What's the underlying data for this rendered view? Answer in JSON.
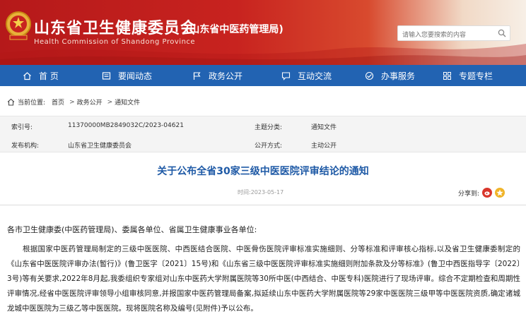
{
  "header": {
    "title": "山东省卫生健康委员会",
    "subtitle": "(山东省中医药管理局)",
    "english": "Health Commission of Shandong Province",
    "search_placeholder": "请输入您要搜索的内容"
  },
  "nav": {
    "items": [
      {
        "label": "首 页",
        "icon": "home-icon"
      },
      {
        "label": "要闻动态",
        "icon": "news-icon"
      },
      {
        "label": "政务公开",
        "icon": "flag-icon"
      },
      {
        "label": "互动交流",
        "icon": "chat-icon"
      },
      {
        "label": "办事服务",
        "icon": "handshake-icon"
      },
      {
        "label": "专题专栏",
        "icon": "grid-icon"
      }
    ]
  },
  "breadcrumb": {
    "prefix": "当前位置:",
    "items": [
      "首页",
      "政务公开",
      "通知文件"
    ]
  },
  "info": {
    "index_label": "索引号:",
    "index_value": "11370000MB2849032C/2023-04621",
    "topic_label": "主题分类:",
    "topic_value": "通知文件",
    "org_label": "发布机构:",
    "org_value": "山东省卫生健康委员会",
    "mode_label": "公开方式:",
    "mode_value": "主动公开"
  },
  "article": {
    "title": "关于公布全省30家三级中医医院评审结论的通知",
    "time": "时间:2023-05-17",
    "share_label": "分享到:",
    "salutation": "各市卫生健康委(中医药管理局)、委属各单位、省属卫生健康事业各单位:",
    "paragraph": "根据国家中医药管理局制定的三级中医医院、中西医结合医院、中医骨伤医院评审标准实施细则、分等标准和评审核心指标,以及省卫生健康委制定的《山东省中医医院评审办法(暂行)》(鲁卫医字〔2021〕15号)和《山东省三级中医医院评审标准实施细则附加条款及分等标准》(鲁卫中西医指导字〔2022〕3号)等有关要求,2022年8月起,我委组织专家组对山东中医药大学附属医院等30所中医(中西结合、中医专科)医院进行了现场评审。综合不定期检查和周期性评审情况,经省中医医院评审领导小组审核同意,并报国家中医药管理局备案,拟延续山东中医药大学附属医院等29家中医医院三级甲等中医医院资质,确定诸城龙城中医医院为三级乙等中医医院。现将医院名称及编号(见附件)予以公布。"
  },
  "colors": {
    "header_red": "#c8231f",
    "nav_blue": "#2263b2",
    "title_blue": "#1f5aa6",
    "share_red": "#d9362b",
    "share_yellow": "#f0b429"
  }
}
